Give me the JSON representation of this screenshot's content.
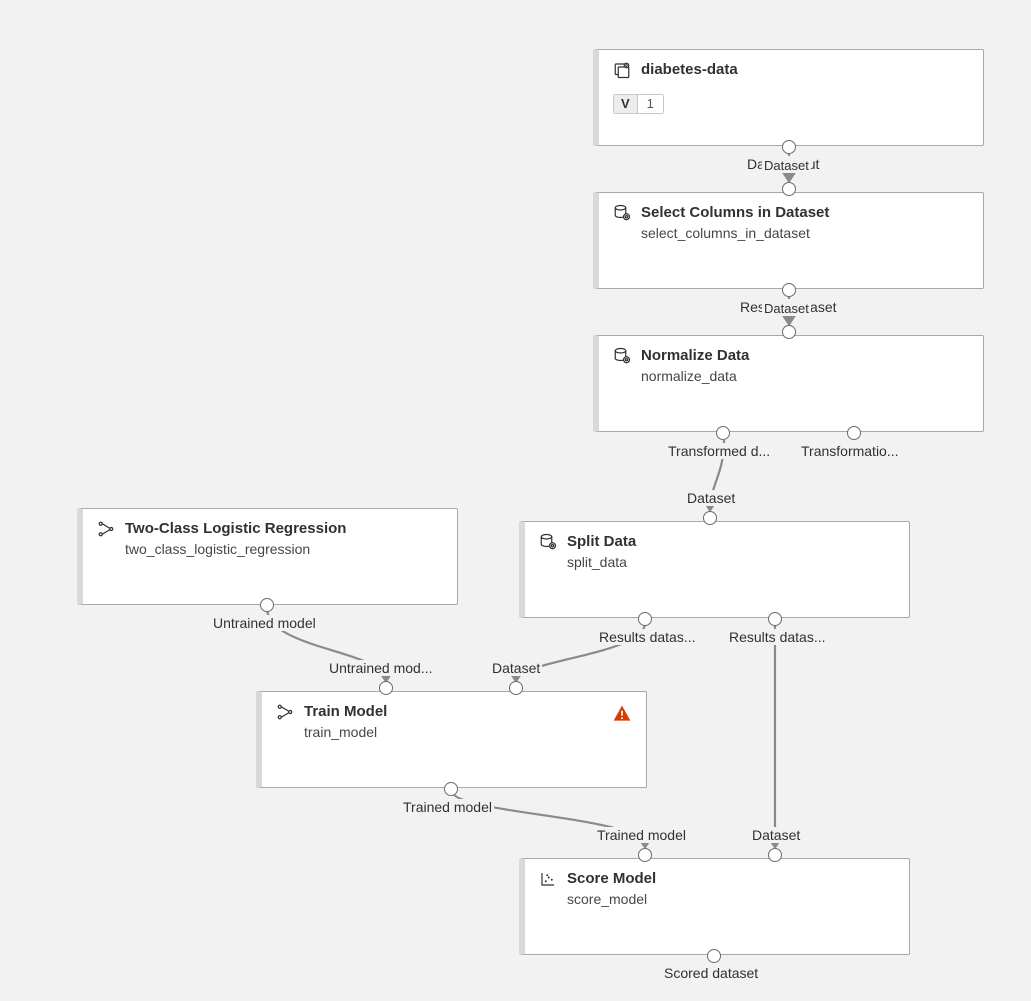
{
  "nodes": {
    "diabetes": {
      "title": "diabetes-data",
      "version_letter": "V",
      "version_number": "1",
      "out1": "Data output",
      "out1b": "Dataset"
    },
    "select_cols": {
      "title": "Select Columns in Dataset",
      "sub": "select_columns_in_dataset",
      "in1": "Dataset",
      "out1": "Results dataset",
      "out1b": "Dataset"
    },
    "normalize": {
      "title": "Normalize Data",
      "sub": "normalize_data",
      "in1": "Dataset",
      "out1": "Transformed d...",
      "out2": "Transformatio..."
    },
    "split": {
      "title": "Split Data",
      "sub": "split_data",
      "in1": "Dataset",
      "out1": "Results datas...",
      "out2": "Results datas..."
    },
    "logreg": {
      "title": "Two-Class Logistic Regression",
      "sub": "two_class_logistic_regression",
      "out1": "Untrained model"
    },
    "train": {
      "title": "Train Model",
      "sub": "train_model",
      "in1": "Untrained mod...",
      "in2": "Dataset",
      "out1": "Trained model"
    },
    "score": {
      "title": "Score Model",
      "sub": "score_model",
      "in1": "Trained model",
      "in2": "Dataset",
      "out1": "Scored dataset"
    }
  }
}
